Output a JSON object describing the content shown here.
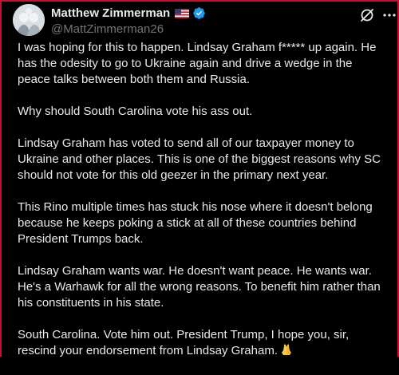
{
  "author": {
    "display_name": "Matthew Zimmerman",
    "flag": "flag-usa-icon",
    "verified": true,
    "handle": "@MattZimmerman26"
  },
  "tweet": {
    "paragraphs": [
      "I was hoping for this to happen. Lindsay Graham f***** up again. He has the odesity to go to Ukraine again and drive a wedge in the peace talks between both them and Russia.",
      "Why should South Carolina vote his ass out.",
      "Lindsay Graham has voted to send all of our taxpayer money to Ukraine and other places. This is one of the biggest reasons why SC should not vote for this old geezer in the primary next year.",
      "This Rino multiple times has stuck his nose where it doesn't belong because he keeps poking a stick at all of these countries behind President Trumps back.",
      "Lindsay Graham wants war. He doesn't want peace. He wants war. He's a Warhawk for all the wrong reasons. To benefit him rather than his constituents in his state.",
      "South Carolina. Vote him out. President Trump, I hope you, sir, rescind your endorsement from Lindsay Graham."
    ]
  },
  "colors": {
    "background": "#000000",
    "text": "#e7e9ea",
    "secondary": "#71767b",
    "verified": "#1d9bf0",
    "border": "#c8102e"
  }
}
